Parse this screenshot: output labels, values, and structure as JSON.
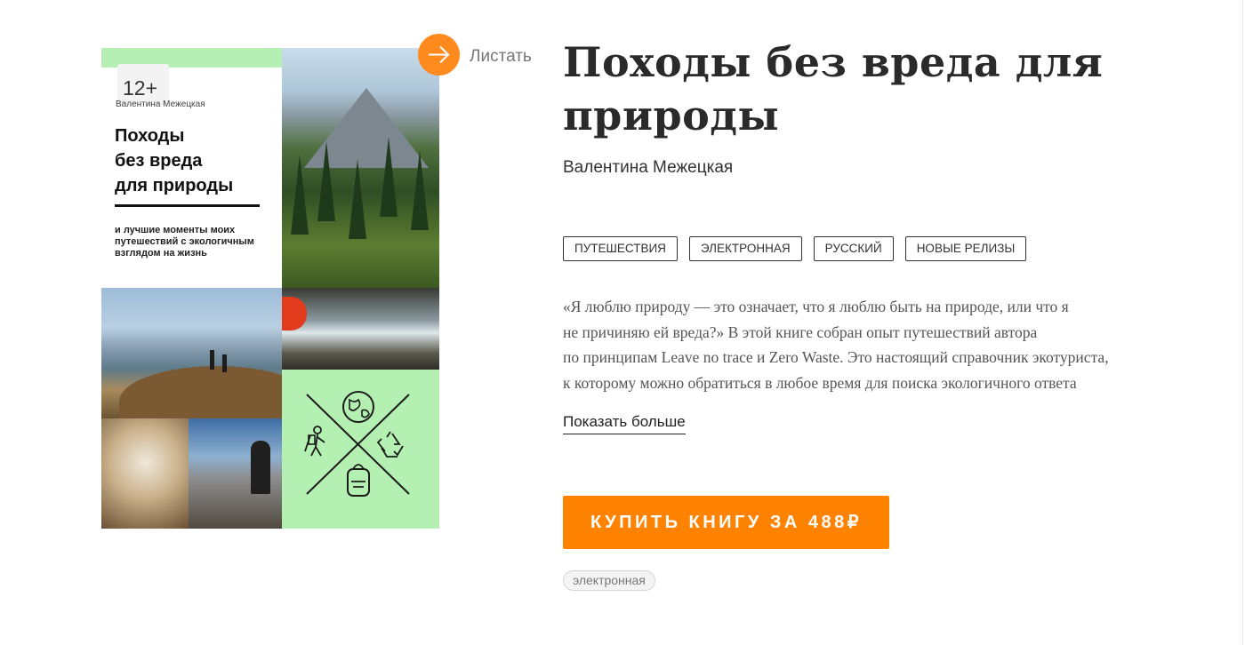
{
  "cover": {
    "age_rating": "12+",
    "author": "Валентина Межецкая",
    "title_lines": [
      "Походы",
      "без вреда",
      "для природы"
    ],
    "subtitle_lines": [
      "и лучшие моменты моих",
      "путешествий с экологичным",
      "взглядом на жизнь"
    ]
  },
  "flip": {
    "label": "Листать",
    "icon": "arrow-right-icon"
  },
  "book": {
    "title_lines": [
      "Походы без вреда для",
      "природы"
    ],
    "author": "Валентина Межецкая"
  },
  "tags": [
    "ПУТЕШЕСТВИЯ",
    "ЭЛЕКТРОННАЯ",
    "РУССКИЙ",
    "НОВЫЕ РЕЛИЗЫ"
  ],
  "description_lines": [
    "«Я люблю природу — это означает, что я люблю быть на природе, или что я",
    "не причиняю ей вреда?» В этой книге собран опыт путешествий автора",
    "по принципам Leave no trace и Zero Waste. Это настоящий справочник экотуриста,",
    "к которому можно обратиться в любое время для поиска экологичного ответа"
  ],
  "show_more_label": "Показать больше",
  "buy_button_label": "КУПИТЬ КНИГУ ЗА 488₽",
  "format_label": "электронная",
  "colors": {
    "accent": "#ff8300",
    "cover_green": "#b5f0b3"
  }
}
